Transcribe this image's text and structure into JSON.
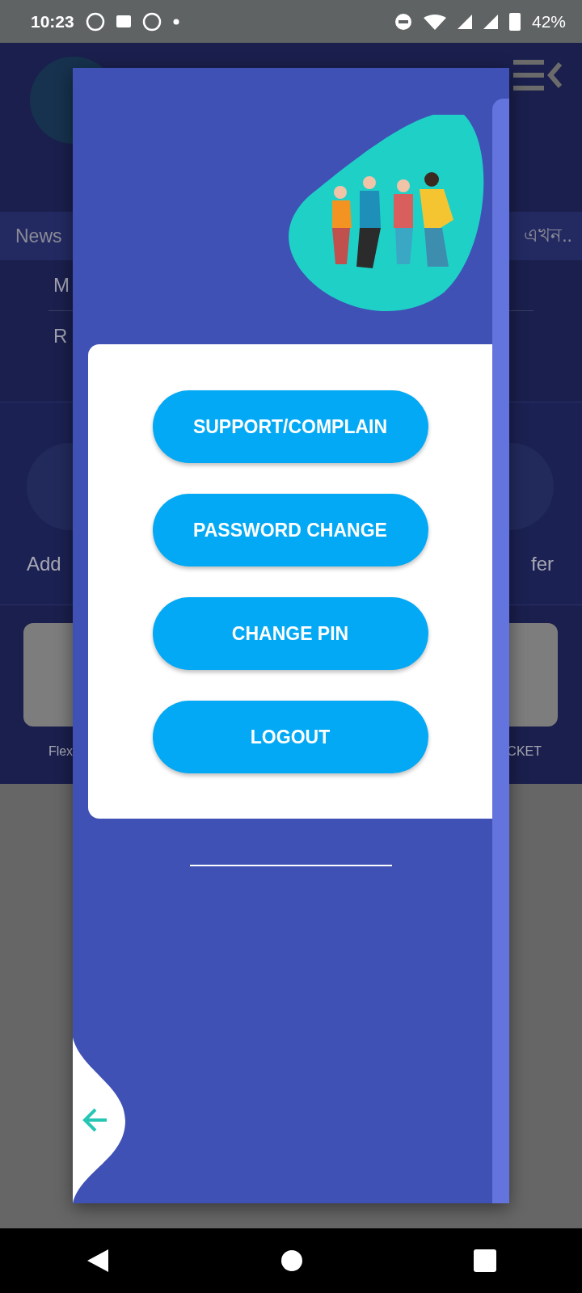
{
  "status_bar": {
    "time": "10:23",
    "battery": "42%"
  },
  "background": {
    "news_label": "News",
    "news_ticker": "এখন..",
    "menu_items": [
      "M",
      "R"
    ],
    "actions": [
      "Add",
      "fer"
    ],
    "tiles": [
      "Flex",
      "CKET"
    ]
  },
  "drawer": {
    "buttons": [
      "SUPPORT/COMPLAIN",
      "PASSWORD CHANGE",
      "CHANGE PIN",
      "LOGOUT"
    ]
  }
}
